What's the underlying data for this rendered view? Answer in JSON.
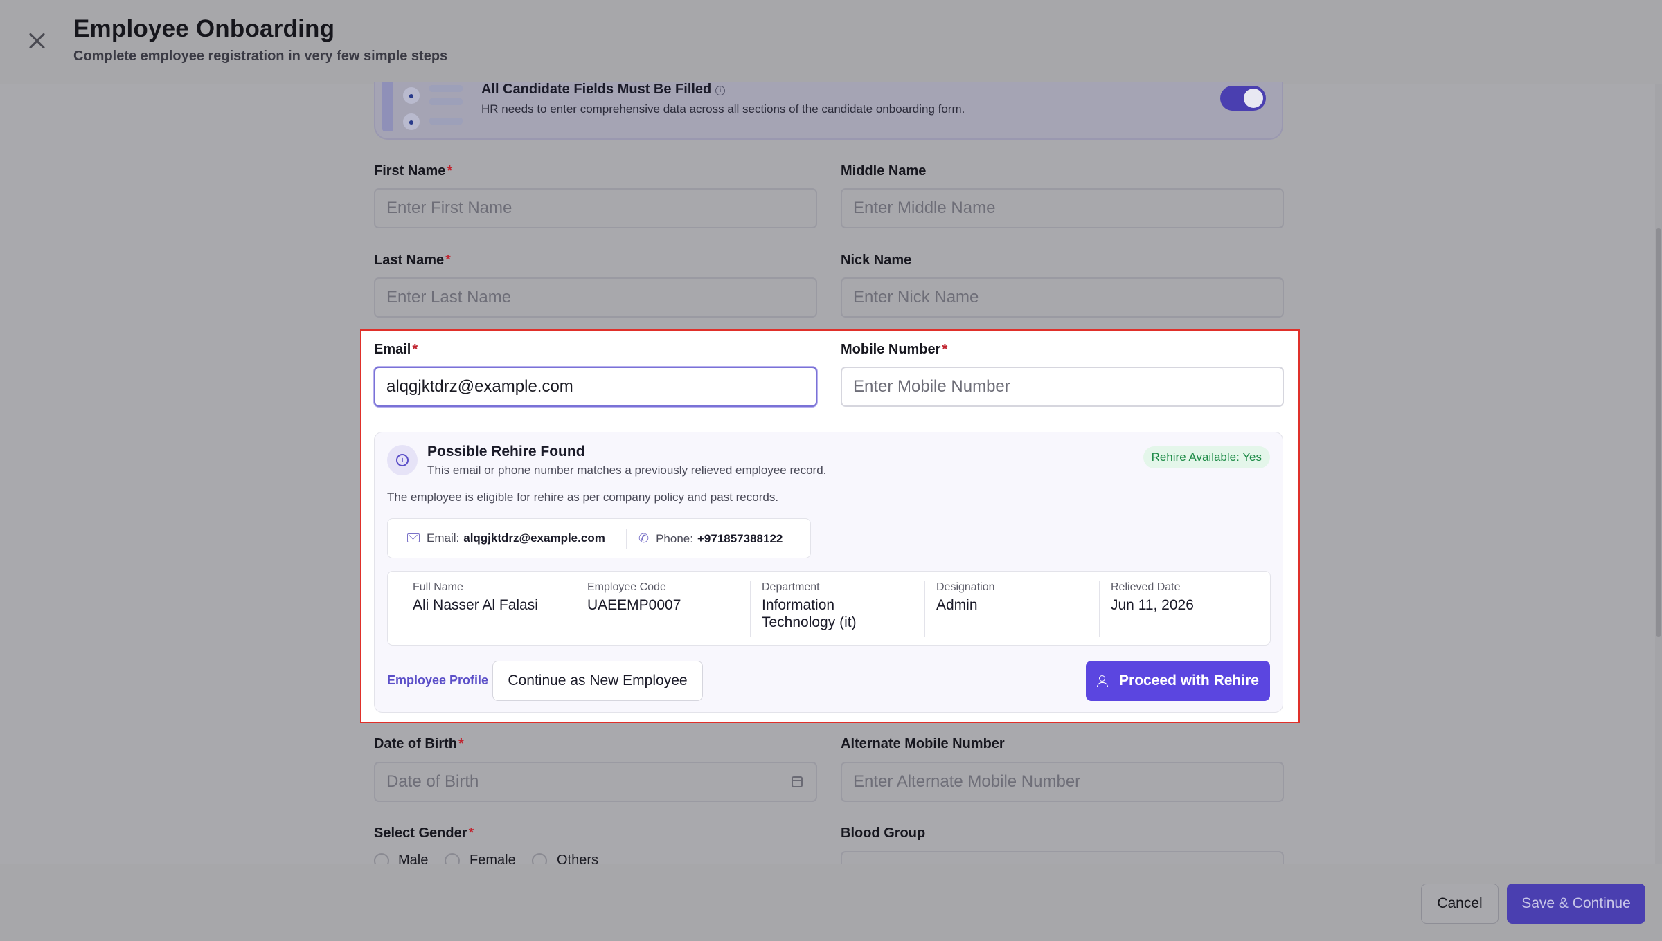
{
  "header": {
    "title": "Employee Onboarding",
    "subtitle": "Complete employee registration in very few simple steps"
  },
  "banner": {
    "title": "All Candidate Fields Must Be Filled",
    "description": "HR needs to enter comprehensive data across all sections of the candidate onboarding form.",
    "toggle_on": true
  },
  "form": {
    "first_name": {
      "label": "First Name",
      "required": "*",
      "placeholder": "Enter First Name"
    },
    "middle_name": {
      "label": "Middle Name",
      "placeholder": "Enter Middle Name"
    },
    "last_name": {
      "label": "Last Name",
      "required": "*",
      "placeholder": "Enter Last Name"
    },
    "nick_name": {
      "label": "Nick Name",
      "placeholder": "Enter Nick Name"
    },
    "email": {
      "label": "Email",
      "required": "*",
      "value": "alqgjktdrz@example.com"
    },
    "mobile": {
      "label": "Mobile Number",
      "required": "*",
      "placeholder": "Enter Mobile Number"
    },
    "dob": {
      "label": "Date of Birth",
      "required": "*",
      "placeholder": "Date of Birth"
    },
    "alt_mobile": {
      "label": "Alternate Mobile Number",
      "placeholder": "Enter Alternate Mobile Number"
    },
    "gender": {
      "label": "Select Gender",
      "required": "*",
      "options": [
        "Male",
        "Female",
        "Others"
      ]
    },
    "blood_group": {
      "label": "Blood Group"
    }
  },
  "rehire": {
    "title": "Possible Rehire Found",
    "subtitle": "This email or phone number matches a previously relieved employee record.",
    "badge": "Rehire Available: Yes",
    "eligible_text": "The employee is eligible for rehire as per company policy and past records.",
    "email_label": "Email:",
    "email_value": "alqgjktdrz@example.com",
    "phone_label": "Phone:",
    "phone_value": "+971857388122",
    "details": [
      {
        "label": "Full Name",
        "value": "Ali Nasser Al Falasi"
      },
      {
        "label": "Employee Code",
        "value": "UAEEMP0007"
      },
      {
        "label": "Department",
        "value": "Information Technology (it)"
      },
      {
        "label": "Designation",
        "value": "Admin"
      },
      {
        "label": "Relieved Date",
        "value": "Jun 11, 2026"
      }
    ],
    "profile_link": "Employee Profile",
    "continue_new": "Continue as New Employee",
    "proceed": "Proceed with Rehire"
  },
  "footer": {
    "cancel": "Cancel",
    "save": "Save & Continue"
  },
  "colors": {
    "accent": "#5b46e0",
    "highlight_border": "#e0302a",
    "badge_text": "#1c8a46",
    "required": "#c1242f"
  }
}
